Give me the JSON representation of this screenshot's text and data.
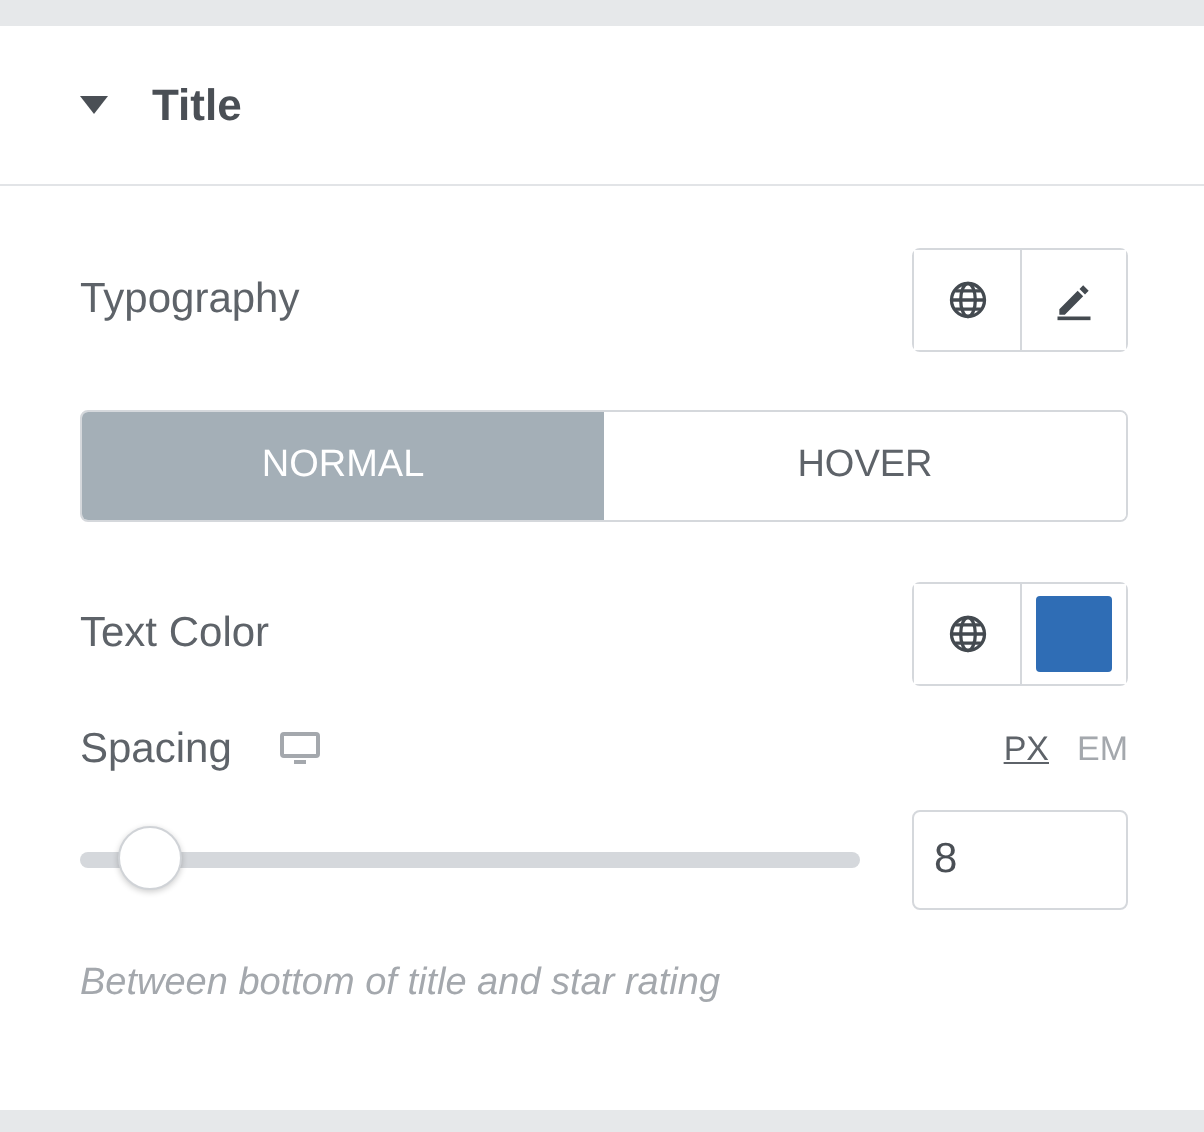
{
  "section": {
    "title": "Title",
    "expanded": true
  },
  "typography": {
    "label": "Typography"
  },
  "state_tabs": [
    {
      "label": "NORMAL",
      "selected": true
    },
    {
      "label": "HOVER",
      "selected": false
    }
  ],
  "text_color": {
    "label": "Text Color",
    "color": "#2f6db5"
  },
  "spacing": {
    "label": "Spacing",
    "units": [
      {
        "label": "PX",
        "selected": true
      },
      {
        "label": "EM",
        "selected": false
      }
    ],
    "level": 0.08,
    "value": "8",
    "help": "Between bottom of title and star rating"
  }
}
